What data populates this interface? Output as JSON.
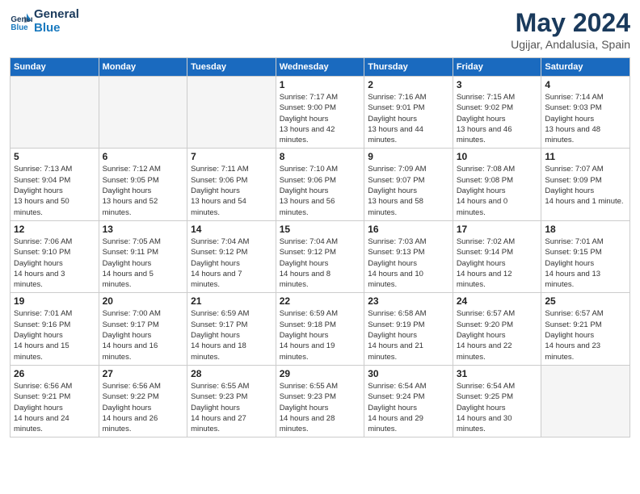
{
  "header": {
    "logo_line1": "General",
    "logo_line2": "Blue",
    "month": "May 2024",
    "location": "Ugijar, Andalusia, Spain"
  },
  "weekdays": [
    "Sunday",
    "Monday",
    "Tuesday",
    "Wednesday",
    "Thursday",
    "Friday",
    "Saturday"
  ],
  "weeks": [
    [
      {
        "day": "",
        "empty": true
      },
      {
        "day": "",
        "empty": true
      },
      {
        "day": "",
        "empty": true
      },
      {
        "day": "1",
        "sunrise": "7:17 AM",
        "sunset": "9:00 PM",
        "daylight": "13 hours and 42 minutes."
      },
      {
        "day": "2",
        "sunrise": "7:16 AM",
        "sunset": "9:01 PM",
        "daylight": "13 hours and 44 minutes."
      },
      {
        "day": "3",
        "sunrise": "7:15 AM",
        "sunset": "9:02 PM",
        "daylight": "13 hours and 46 minutes."
      },
      {
        "day": "4",
        "sunrise": "7:14 AM",
        "sunset": "9:03 PM",
        "daylight": "13 hours and 48 minutes."
      }
    ],
    [
      {
        "day": "5",
        "sunrise": "7:13 AM",
        "sunset": "9:04 PM",
        "daylight": "13 hours and 50 minutes."
      },
      {
        "day": "6",
        "sunrise": "7:12 AM",
        "sunset": "9:05 PM",
        "daylight": "13 hours and 52 minutes."
      },
      {
        "day": "7",
        "sunrise": "7:11 AM",
        "sunset": "9:06 PM",
        "daylight": "13 hours and 54 minutes."
      },
      {
        "day": "8",
        "sunrise": "7:10 AM",
        "sunset": "9:06 PM",
        "daylight": "13 hours and 56 minutes."
      },
      {
        "day": "9",
        "sunrise": "7:09 AM",
        "sunset": "9:07 PM",
        "daylight": "13 hours and 58 minutes."
      },
      {
        "day": "10",
        "sunrise": "7:08 AM",
        "sunset": "9:08 PM",
        "daylight": "14 hours and 0 minutes."
      },
      {
        "day": "11",
        "sunrise": "7:07 AM",
        "sunset": "9:09 PM",
        "daylight": "14 hours and 1 minute."
      }
    ],
    [
      {
        "day": "12",
        "sunrise": "7:06 AM",
        "sunset": "9:10 PM",
        "daylight": "14 hours and 3 minutes."
      },
      {
        "day": "13",
        "sunrise": "7:05 AM",
        "sunset": "9:11 PM",
        "daylight": "14 hours and 5 minutes."
      },
      {
        "day": "14",
        "sunrise": "7:04 AM",
        "sunset": "9:12 PM",
        "daylight": "14 hours and 7 minutes."
      },
      {
        "day": "15",
        "sunrise": "7:04 AM",
        "sunset": "9:12 PM",
        "daylight": "14 hours and 8 minutes."
      },
      {
        "day": "16",
        "sunrise": "7:03 AM",
        "sunset": "9:13 PM",
        "daylight": "14 hours and 10 minutes."
      },
      {
        "day": "17",
        "sunrise": "7:02 AM",
        "sunset": "9:14 PM",
        "daylight": "14 hours and 12 minutes."
      },
      {
        "day": "18",
        "sunrise": "7:01 AM",
        "sunset": "9:15 PM",
        "daylight": "14 hours and 13 minutes."
      }
    ],
    [
      {
        "day": "19",
        "sunrise": "7:01 AM",
        "sunset": "9:16 PM",
        "daylight": "14 hours and 15 minutes."
      },
      {
        "day": "20",
        "sunrise": "7:00 AM",
        "sunset": "9:17 PM",
        "daylight": "14 hours and 16 minutes."
      },
      {
        "day": "21",
        "sunrise": "6:59 AM",
        "sunset": "9:17 PM",
        "daylight": "14 hours and 18 minutes."
      },
      {
        "day": "22",
        "sunrise": "6:59 AM",
        "sunset": "9:18 PM",
        "daylight": "14 hours and 19 minutes."
      },
      {
        "day": "23",
        "sunrise": "6:58 AM",
        "sunset": "9:19 PM",
        "daylight": "14 hours and 21 minutes."
      },
      {
        "day": "24",
        "sunrise": "6:57 AM",
        "sunset": "9:20 PM",
        "daylight": "14 hours and 22 minutes."
      },
      {
        "day": "25",
        "sunrise": "6:57 AM",
        "sunset": "9:21 PM",
        "daylight": "14 hours and 23 minutes."
      }
    ],
    [
      {
        "day": "26",
        "sunrise": "6:56 AM",
        "sunset": "9:21 PM",
        "daylight": "14 hours and 24 minutes."
      },
      {
        "day": "27",
        "sunrise": "6:56 AM",
        "sunset": "9:22 PM",
        "daylight": "14 hours and 26 minutes."
      },
      {
        "day": "28",
        "sunrise": "6:55 AM",
        "sunset": "9:23 PM",
        "daylight": "14 hours and 27 minutes."
      },
      {
        "day": "29",
        "sunrise": "6:55 AM",
        "sunset": "9:23 PM",
        "daylight": "14 hours and 28 minutes."
      },
      {
        "day": "30",
        "sunrise": "6:54 AM",
        "sunset": "9:24 PM",
        "daylight": "14 hours and 29 minutes."
      },
      {
        "day": "31",
        "sunrise": "6:54 AM",
        "sunset": "9:25 PM",
        "daylight": "14 hours and 30 minutes."
      },
      {
        "day": "",
        "empty": true
      }
    ]
  ]
}
